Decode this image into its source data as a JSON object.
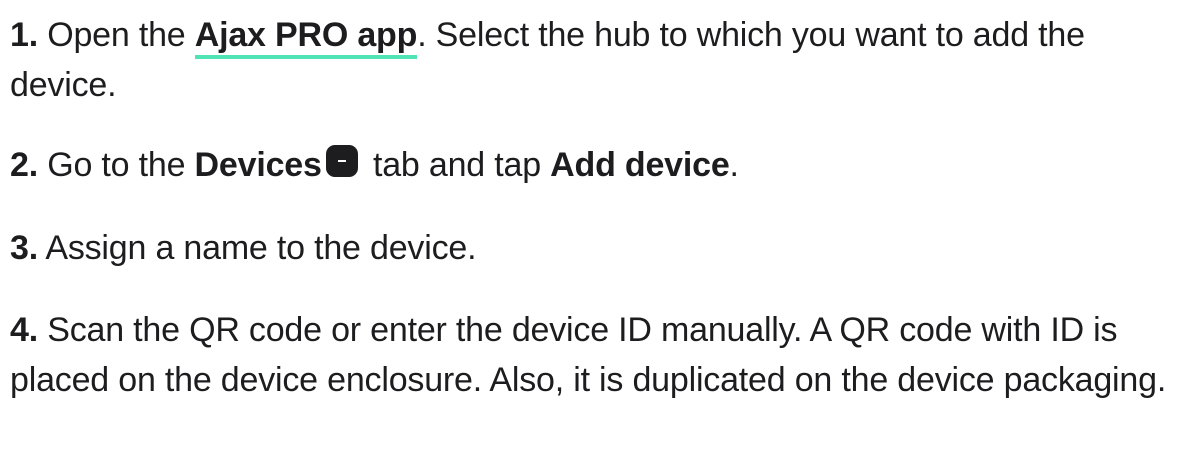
{
  "steps": [
    {
      "number": "1.",
      "text_before": "Open the ",
      "link": "Ajax PRO app",
      "text_after": ". Select the hub to which you want to add the device."
    },
    {
      "number": "2.",
      "text_before": "Go to the ",
      "bold1": "Devices",
      "icon": "devices-tab-icon",
      "text_middle": " tab and tap ",
      "bold2": "Add device",
      "text_after": "."
    },
    {
      "number": "3.",
      "text": "Assign a name to the device."
    },
    {
      "number": "4.",
      "text": "Scan the QR code or enter the device ID manually. A QR code with ID is placed on the device enclosure. Also, it is duplicated on the device packaging."
    }
  ],
  "colors": {
    "text": "#1d1d1f",
    "link_underline": "#4fe3b6",
    "icon_background": "#1d1d1f"
  }
}
